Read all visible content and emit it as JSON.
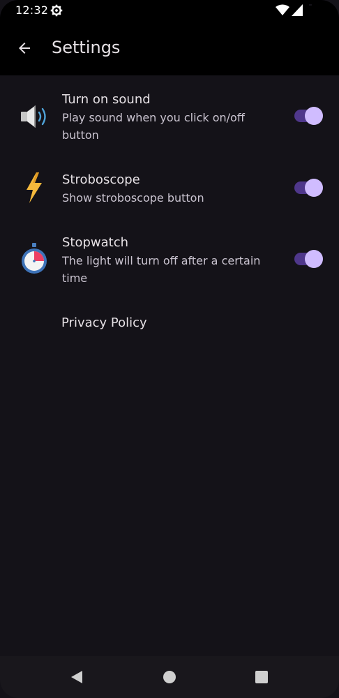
{
  "status_bar": {
    "time": "12:32",
    "icons": [
      "gear-icon",
      "wifi-icon",
      "signal-icon",
      "battery-icon"
    ]
  },
  "app_bar": {
    "title": "Settings",
    "back_icon": "arrow-back-icon"
  },
  "settings": [
    {
      "title": "Turn on sound",
      "subtitle": "Play sound when you click on/off button",
      "icon": "speaker-icon",
      "enabled": true
    },
    {
      "title": "Stroboscope",
      "subtitle": "Show stroboscope button",
      "icon": "lightning-icon",
      "enabled": true
    },
    {
      "title": "Stopwatch",
      "subtitle": "The light will turn off after a certain time",
      "icon": "stopwatch-icon",
      "enabled": true
    }
  ],
  "privacy_policy": {
    "label": "Privacy Policy"
  },
  "nav_bar": {
    "icons": [
      "nav-back-icon",
      "nav-home-icon",
      "nav-recents-icon"
    ]
  },
  "colors": {
    "background": "#141218",
    "app_bar": "#000000",
    "switch_track": "#4f378b",
    "switch_thumb": "#d0bcff",
    "text_primary": "#e6e1e5",
    "text_secondary": "#cac4d0"
  }
}
